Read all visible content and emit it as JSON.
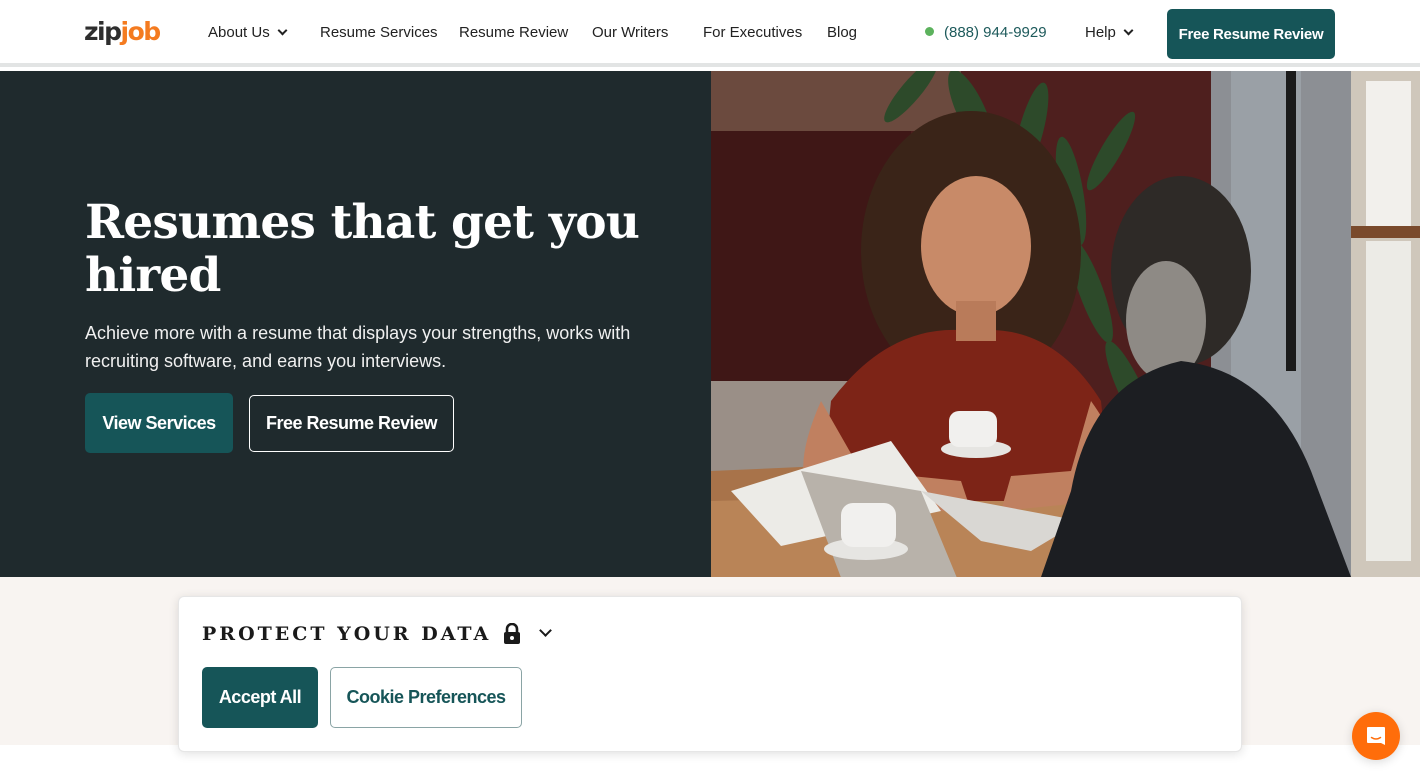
{
  "header": {
    "logo": {
      "part1": "zip",
      "part2": "job"
    },
    "nav": [
      {
        "label": "About Us",
        "has_dropdown": true
      },
      {
        "label": "Resume Services",
        "has_dropdown": false
      },
      {
        "label": "Resume Review",
        "has_dropdown": false
      },
      {
        "label": "Our Writers",
        "has_dropdown": false
      },
      {
        "label": "For Executives",
        "has_dropdown": false
      },
      {
        "label": "Blog",
        "has_dropdown": false
      }
    ],
    "phone": "(888) 944-9929",
    "help_label": "Help",
    "cta_label": "Free Resume Review"
  },
  "hero": {
    "title": "Resumes that get you hired",
    "subtitle": "Achieve more with a resume that displays your strengths, works with recruiting software, and earns you interviews.",
    "primary_button": "View Services",
    "secondary_button": "Free Resume Review",
    "image_alt": "Woman and man meeting at a cafe table with a laptop and coffee cups"
  },
  "cookie_banner": {
    "title": "PROTECT YOUR DATA",
    "lock_icon": "lock-icon",
    "expand_icon": "chevron-down-icon",
    "accept_label": "Accept All",
    "preferences_label": "Cookie Preferences"
  },
  "chat_widget": {
    "icon": "chat-smile-icon"
  },
  "colors": {
    "brand_teal": "#165558",
    "hero_bg": "#1f2a2d",
    "logo_orange": "#f47b20",
    "phone_dot": "#5cb25d",
    "band_bg": "#f8f4f1",
    "chat_orange": "#ff6d0a"
  }
}
